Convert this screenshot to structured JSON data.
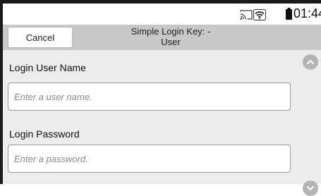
{
  "status_bar": {
    "time": "01:44",
    "icons": [
      "cast-icon",
      "wifi-icon",
      "battery-icon"
    ]
  },
  "header": {
    "cancel_label": "Cancel",
    "title_line1": "Simple Login Key: -",
    "title_line2": "User"
  },
  "form": {
    "username": {
      "label": "Login User Name",
      "value": "",
      "placeholder": "Enter a user name."
    },
    "password": {
      "label": "Login Password",
      "value": "",
      "placeholder": "Enter a password."
    }
  },
  "scroll": {
    "up_icon": "chevron-up-icon",
    "down_icon": "chevron-down-icon"
  },
  "colors": {
    "header_bg": "#c8c8c8",
    "content_bg": "#ececec",
    "scroll_button": "#b4b4b4"
  }
}
